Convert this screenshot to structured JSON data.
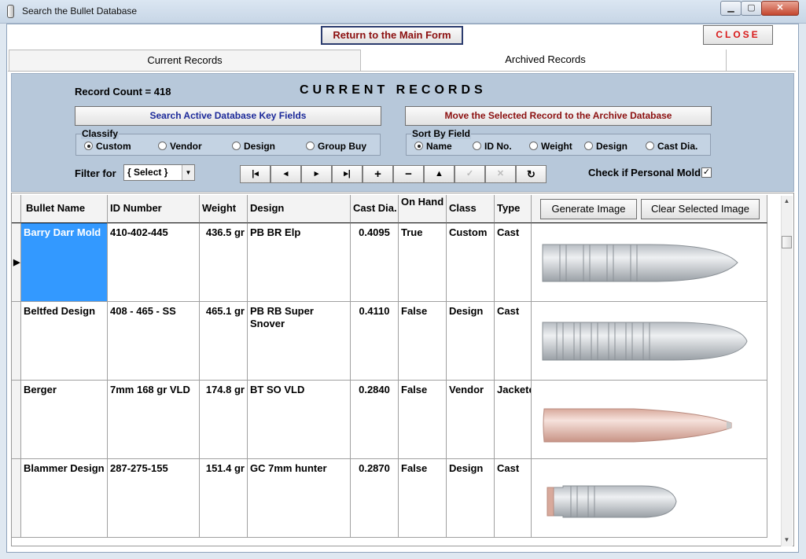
{
  "window": {
    "title": "Search the Bullet Database"
  },
  "toolbar": {
    "return_label": "Return to the Main Form",
    "close_label": "CLOSE"
  },
  "tabs": [
    {
      "label": "Current Records"
    },
    {
      "label": "Archived Records"
    }
  ],
  "panel": {
    "record_count": "Record Count = 418",
    "title": "CURRENT RECORDS",
    "search_button": "Search Active Database  Key Fields",
    "move_button": "Move the Selected Record to the Archive Database",
    "classify": {
      "label": "Classify",
      "options": [
        "Custom",
        "Vendor",
        "Design",
        "Group Buy"
      ],
      "selected": "Custom"
    },
    "sort": {
      "label": "Sort By Field",
      "options": [
        "Name",
        "ID No.",
        "Weight",
        "Design",
        "Cast Dia."
      ],
      "selected": "Name"
    },
    "filter": {
      "label": "Filter for",
      "value": "{ Select }"
    },
    "personal_mold": {
      "label": "Check if Personal Mold",
      "checked": true
    }
  },
  "nav_buttons": [
    "first-record-icon",
    "prev-record-icon",
    "next-record-icon",
    "last-record-icon",
    "add-record-icon",
    "delete-record-icon",
    "save-up-icon",
    "undo-check-icon",
    "cancel-x-icon",
    "refresh-icon"
  ],
  "grid": {
    "columns": [
      "Bullet Name",
      "ID Number",
      "Weight",
      "Design",
      "Cast Dia.",
      "On Hand",
      "Class",
      "Type"
    ],
    "generate_image": "Generate Image",
    "clear_image": "Clear Selected Image",
    "rows": [
      {
        "name": "Barry Darr Mold",
        "id": "410-402-445",
        "weight": "436.5 gr",
        "design": "PB BR Elp",
        "cast_dia": "0.4095",
        "on_hand": "True",
        "class": "Custom",
        "type": "Cast",
        "bullet": "cast-long"
      },
      {
        "name": "Beltfed Design",
        "id": "408 - 465 - SS",
        "weight": "465.1 gr",
        "design": "PB RB Super Snover",
        "cast_dia": "0.4110",
        "on_hand": "False",
        "class": "Design",
        "type": "Cast",
        "bullet": "cast-grooved"
      },
      {
        "name": "Berger",
        "id": "7mm 168 gr VLD",
        "weight": "174.8 gr",
        "design": "BT SO VLD",
        "cast_dia": "0.2840",
        "on_hand": "False",
        "class": "Vendor",
        "type": "Jacketed",
        "bullet": "jacketed"
      },
      {
        "name": "Blammer Design",
        "id": "287-275-155",
        "weight": "151.4 gr",
        "design": "GC 7mm hunter",
        "cast_dia": "0.2870",
        "on_hand": "False",
        "class": "Design",
        "type": "Cast",
        "bullet": "cast-short"
      }
    ],
    "selected_row": 0
  },
  "colors": {
    "panel": "#b7c8da",
    "selection": "#3399ff",
    "return_text": "#8c1010",
    "close_text": "#d81818"
  }
}
